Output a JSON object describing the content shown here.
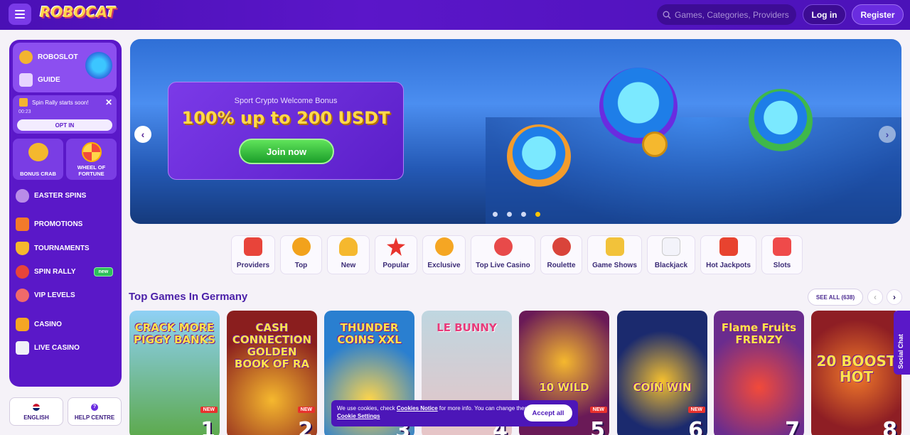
{
  "header": {
    "logo": "ROBOCAT",
    "search_placeholder": "Games, Categories, Providers",
    "login": "Log in",
    "register": "Register"
  },
  "sidebar": {
    "roboslot": "ROBOSLOT",
    "guide": "GUIDE",
    "rally_notice": "Spin Rally starts soon!",
    "rally_timer": "00:23",
    "opt_in": "OPT IN",
    "tiles": [
      {
        "label": "BONUS CRAB"
      },
      {
        "label": "WHEEL OF FORTUNE"
      }
    ],
    "items": [
      {
        "label": "EASTER SPINS"
      },
      {
        "label": "PROMOTIONS"
      },
      {
        "label": "TOURNAMENTS"
      },
      {
        "label": "SPIN RALLY",
        "badge": "new"
      },
      {
        "label": "VIP LEVELS"
      },
      {
        "label": "CASINO"
      },
      {
        "label": "LIVE CASINO"
      }
    ],
    "language": "ENGLISH",
    "help": "HELP CENTRE"
  },
  "banner": {
    "subtitle": "Sport Crypto Welcome Bonus",
    "title": "100% up to 200 USDT",
    "cta": "Join now",
    "slide_count": 4,
    "active_slide": 4
  },
  "categories": [
    {
      "label": "Providers",
      "color": "#e8443a"
    },
    {
      "label": "Top",
      "color": "#f2a21c"
    },
    {
      "label": "New",
      "color": "#f5b82e"
    },
    {
      "label": "Popular",
      "color": "#e8332d"
    },
    {
      "label": "Exclusive",
      "color": "#f5a623"
    },
    {
      "label": "Top Live Casino",
      "color": "#e84a4a"
    },
    {
      "label": "Roulette",
      "color": "#d9443a"
    },
    {
      "label": "Game Shows",
      "color": "#f2c23a"
    },
    {
      "label": "Blackjack",
      "color": "#e5e5ef"
    },
    {
      "label": "Hot Jackpots",
      "color": "#e8432f"
    },
    {
      "label": "Slots",
      "color": "#ef4a4a"
    }
  ],
  "section": {
    "title": "Top Games In Germany",
    "see_all": "SEE ALL (638)"
  },
  "games": [
    {
      "name": "CRACK MORE PIGGY BANKS",
      "rank": "1",
      "new": "NEW",
      "bg": "#6fb6e8"
    },
    {
      "name": "CASH CONNECTION GOLDEN BOOK OF RA",
      "rank": "2",
      "new": "NEW",
      "bg": "#7a1d1d"
    },
    {
      "name": "THUNDER COINS XXL",
      "rank": "3",
      "new": "",
      "bg": "#2a7fd0"
    },
    {
      "name": "LE BUNNY",
      "rank": "4",
      "new": "",
      "bg": "#e9c7c9"
    },
    {
      "name": "10 WILD",
      "rank": "5",
      "new": "NEW",
      "bg": "#6a1a57"
    },
    {
      "name": "COIN WIN",
      "rank": "6",
      "new": "NEW",
      "bg": "#1b2a6e"
    },
    {
      "name": "Flame Fruits FRENZY",
      "rank": "7",
      "new": "",
      "bg": "#6a2c8e"
    },
    {
      "name": "20 BOOST HOT",
      "rank": "8",
      "new": "",
      "bg": "#a8242a"
    }
  ],
  "cookie": {
    "text_a": "We use cookies, check ",
    "link_a": "Cookies Notice",
    "text_b": " for more info. You can change these settings in ",
    "link_b": "Cookie Settings",
    "accept": "Accept all"
  },
  "social": "Social Chat"
}
